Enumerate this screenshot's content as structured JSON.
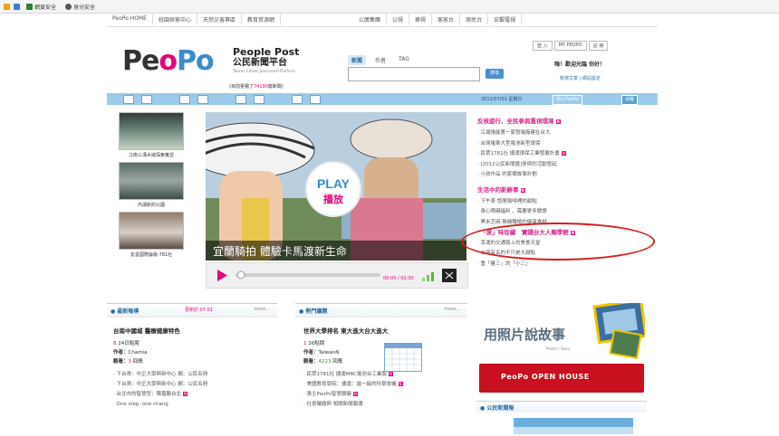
{
  "browser_toolbar": {
    "items": [
      {
        "label": "網頁安全"
      },
      {
        "label": "身分安全"
      }
    ]
  },
  "top_nav": {
    "items": [
      "PeoPo HOME",
      "校園探索中心",
      "天然災害專區",
      "教育資源網",
      "公廣集團",
      "公視",
      "華視",
      "客家台",
      "原民台",
      "宏觀電視"
    ]
  },
  "logo": {
    "brand": [
      "Pe",
      "o",
      "Po"
    ],
    "title_en": "People Post",
    "title_zh": "公民新聞平台",
    "subtitle": "Taiwan Citizen Journalism Platform",
    "stat_prefix": "目前累積了",
    "stat_number": "74190",
    "stat_suffix": "篇新聞"
  },
  "search": {
    "tabs": [
      {
        "label": "新聞",
        "active": true
      },
      {
        "label": "作者",
        "active": false
      },
      {
        "label": "TAG",
        "active": false
      }
    ],
    "button_label": "搜尋"
  },
  "account": {
    "links": [
      "登 入",
      "MY PEOPO",
      "註 冊"
    ],
    "greeting": "嗨！歡迎光臨 你好！",
    "secondary": "新增文章 | 網站設定"
  },
  "subbar": {
    "date": "2012/07/01 星期日",
    "buttons": [
      "加入PeoPo",
      "追蹤"
    ]
  },
  "thumbnails": [
    {
      "caption": "江南三溝水域探索實習"
    },
    {
      "caption": "內湖新的公園"
    },
    {
      "caption": "友善國際論壇-781社"
    }
  ],
  "video": {
    "play_label": "PLAY",
    "play_label_zh": "播放",
    "caption": "宜蘭騎拍 體驗卡馬渡新生命",
    "time": "00:00 / 02:00"
  },
  "right_column": {
    "section1_title": "反核遊行、全民參與重視環境",
    "section1_items": [
      "江湖綠能第一家發電廠建在台大",
      "台灣電車大型電池新型環保",
      "民眾1781社 捷運環保工業發展計畫",
      "[2012公民新聞獎]參與的活動發起",
      "小孩作品 的家鄉故事計劃"
    ],
    "section2_title": "生活中的新鮮事",
    "section2_items": [
      "下午茶 悠閒咖啡裡的甜點",
      "身心障礙福利 ，需要更多關懷",
      "黑米芝麻 無機種植的健康食材"
    ],
    "highlight": "「原」味珍藏　實踐台大人類學館",
    "section3_items": [
      "幸運的交通路上的美食天堂",
      "台灣有名的不只是大甜點",
      "重「雞三」的「小三」"
    ]
  },
  "panels": {
    "left": {
      "title": "● 最新報導",
      "updated": "更新於 07:01",
      "more": "more..."
    },
    "mid": {
      "title": "● 熱門議題",
      "more": "more..."
    }
  },
  "left_article": {
    "title": "台南中國城 醫療健康特色",
    "views_num": "8",
    "views_suffix": "24日點閱",
    "author_label": "作者：",
    "author": "Chamia",
    "comments_label": "觀看：",
    "comments_num": "3",
    "comments_suffix": "回應",
    "list": [
      "下台灣：中正大學與新中心 網：公民名冊",
      "下台灣：中正大學與新中心 網：公民名冊",
      "台北市的智慧型：陳嘉鵬台北",
      "One step, one chang"
    ]
  },
  "mid_article": {
    "title": "世界大學排名 東大進大台大進大",
    "views_num": "1",
    "views_suffix": "26點閱",
    "author_label": "作者：",
    "author": "TaiwanN",
    "comments_label": "觀看：",
    "comments_num": "4223",
    "comments_suffix": "回應",
    "list": [
      "民眾1781社 捷運MRC電池台工業製",
      "美國教育學院：捷運：進一級的科學會議",
      "張主PeoPo智慧關鍵",
      "社會議題與 相關新聞報導"
    ]
  },
  "story_banner": {
    "title": "用照片說故事",
    "subtitle": "Photo's Story"
  },
  "open_house": {
    "label": "PeoPo OPEN HOUSE"
  },
  "citizen_channel": {
    "title": "● 公民新聞報"
  },
  "colors": {
    "brand_pink": "#e6007e",
    "brand_blue": "#3a8cc8",
    "subbar_blue": "#9ccbe9",
    "highlight_red": "#d42020",
    "openhouse_red": "#c8101e"
  }
}
